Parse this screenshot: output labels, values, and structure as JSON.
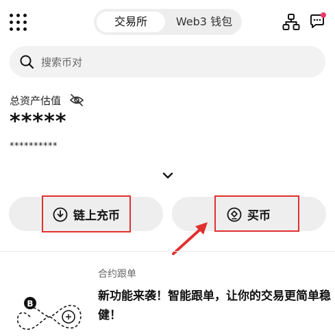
{
  "header": {
    "tabs": [
      {
        "label": "交易所",
        "active": true
      },
      {
        "label": "Web3 钱包",
        "active": false
      }
    ],
    "icons": {
      "menu": "grid-menu-icon",
      "network": "network-icon",
      "chat": "chat-icon"
    },
    "notification_dot_color": "#f0386a"
  },
  "search": {
    "placeholder": "搜索币对"
  },
  "assets": {
    "label": "总资产估值",
    "value": "*****",
    "sub_value": "**********"
  },
  "actions": {
    "deposit_label": "链上充币",
    "buy_label": "买币",
    "highlight_color": "#e0302f"
  },
  "promo": {
    "tag": "合约跟单",
    "title": "新功能来袭！智能跟单，让你的交易更简单稳健！"
  }
}
